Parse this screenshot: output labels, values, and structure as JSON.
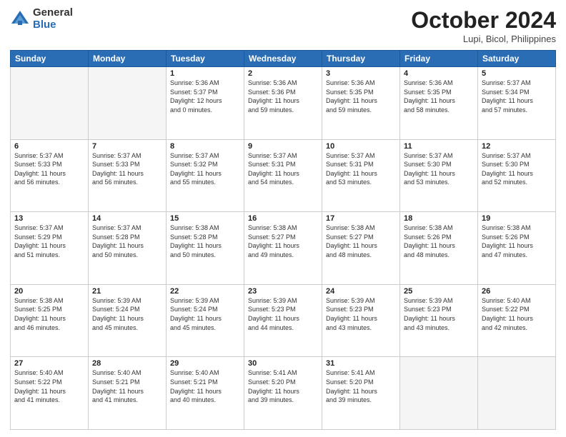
{
  "header": {
    "logo_general": "General",
    "logo_blue": "Blue",
    "month_title": "October 2024",
    "location": "Lupi, Bicol, Philippines"
  },
  "weekdays": [
    "Sunday",
    "Monday",
    "Tuesday",
    "Wednesday",
    "Thursday",
    "Friday",
    "Saturday"
  ],
  "weeks": [
    [
      {
        "day": "",
        "detail": ""
      },
      {
        "day": "",
        "detail": ""
      },
      {
        "day": "1",
        "detail": "Sunrise: 5:36 AM\nSunset: 5:37 PM\nDaylight: 12 hours\nand 0 minutes."
      },
      {
        "day": "2",
        "detail": "Sunrise: 5:36 AM\nSunset: 5:36 PM\nDaylight: 11 hours\nand 59 minutes."
      },
      {
        "day": "3",
        "detail": "Sunrise: 5:36 AM\nSunset: 5:35 PM\nDaylight: 11 hours\nand 59 minutes."
      },
      {
        "day": "4",
        "detail": "Sunrise: 5:36 AM\nSunset: 5:35 PM\nDaylight: 11 hours\nand 58 minutes."
      },
      {
        "day": "5",
        "detail": "Sunrise: 5:37 AM\nSunset: 5:34 PM\nDaylight: 11 hours\nand 57 minutes."
      }
    ],
    [
      {
        "day": "6",
        "detail": "Sunrise: 5:37 AM\nSunset: 5:33 PM\nDaylight: 11 hours\nand 56 minutes."
      },
      {
        "day": "7",
        "detail": "Sunrise: 5:37 AM\nSunset: 5:33 PM\nDaylight: 11 hours\nand 56 minutes."
      },
      {
        "day": "8",
        "detail": "Sunrise: 5:37 AM\nSunset: 5:32 PM\nDaylight: 11 hours\nand 55 minutes."
      },
      {
        "day": "9",
        "detail": "Sunrise: 5:37 AM\nSunset: 5:31 PM\nDaylight: 11 hours\nand 54 minutes."
      },
      {
        "day": "10",
        "detail": "Sunrise: 5:37 AM\nSunset: 5:31 PM\nDaylight: 11 hours\nand 53 minutes."
      },
      {
        "day": "11",
        "detail": "Sunrise: 5:37 AM\nSunset: 5:30 PM\nDaylight: 11 hours\nand 53 minutes."
      },
      {
        "day": "12",
        "detail": "Sunrise: 5:37 AM\nSunset: 5:30 PM\nDaylight: 11 hours\nand 52 minutes."
      }
    ],
    [
      {
        "day": "13",
        "detail": "Sunrise: 5:37 AM\nSunset: 5:29 PM\nDaylight: 11 hours\nand 51 minutes."
      },
      {
        "day": "14",
        "detail": "Sunrise: 5:37 AM\nSunset: 5:28 PM\nDaylight: 11 hours\nand 50 minutes."
      },
      {
        "day": "15",
        "detail": "Sunrise: 5:38 AM\nSunset: 5:28 PM\nDaylight: 11 hours\nand 50 minutes."
      },
      {
        "day": "16",
        "detail": "Sunrise: 5:38 AM\nSunset: 5:27 PM\nDaylight: 11 hours\nand 49 minutes."
      },
      {
        "day": "17",
        "detail": "Sunrise: 5:38 AM\nSunset: 5:27 PM\nDaylight: 11 hours\nand 48 minutes."
      },
      {
        "day": "18",
        "detail": "Sunrise: 5:38 AM\nSunset: 5:26 PM\nDaylight: 11 hours\nand 48 minutes."
      },
      {
        "day": "19",
        "detail": "Sunrise: 5:38 AM\nSunset: 5:26 PM\nDaylight: 11 hours\nand 47 minutes."
      }
    ],
    [
      {
        "day": "20",
        "detail": "Sunrise: 5:38 AM\nSunset: 5:25 PM\nDaylight: 11 hours\nand 46 minutes."
      },
      {
        "day": "21",
        "detail": "Sunrise: 5:39 AM\nSunset: 5:24 PM\nDaylight: 11 hours\nand 45 minutes."
      },
      {
        "day": "22",
        "detail": "Sunrise: 5:39 AM\nSunset: 5:24 PM\nDaylight: 11 hours\nand 45 minutes."
      },
      {
        "day": "23",
        "detail": "Sunrise: 5:39 AM\nSunset: 5:23 PM\nDaylight: 11 hours\nand 44 minutes."
      },
      {
        "day": "24",
        "detail": "Sunrise: 5:39 AM\nSunset: 5:23 PM\nDaylight: 11 hours\nand 43 minutes."
      },
      {
        "day": "25",
        "detail": "Sunrise: 5:39 AM\nSunset: 5:23 PM\nDaylight: 11 hours\nand 43 minutes."
      },
      {
        "day": "26",
        "detail": "Sunrise: 5:40 AM\nSunset: 5:22 PM\nDaylight: 11 hours\nand 42 minutes."
      }
    ],
    [
      {
        "day": "27",
        "detail": "Sunrise: 5:40 AM\nSunset: 5:22 PM\nDaylight: 11 hours\nand 41 minutes."
      },
      {
        "day": "28",
        "detail": "Sunrise: 5:40 AM\nSunset: 5:21 PM\nDaylight: 11 hours\nand 41 minutes."
      },
      {
        "day": "29",
        "detail": "Sunrise: 5:40 AM\nSunset: 5:21 PM\nDaylight: 11 hours\nand 40 minutes."
      },
      {
        "day": "30",
        "detail": "Sunrise: 5:41 AM\nSunset: 5:20 PM\nDaylight: 11 hours\nand 39 minutes."
      },
      {
        "day": "31",
        "detail": "Sunrise: 5:41 AM\nSunset: 5:20 PM\nDaylight: 11 hours\nand 39 minutes."
      },
      {
        "day": "",
        "detail": ""
      },
      {
        "day": "",
        "detail": ""
      }
    ]
  ]
}
